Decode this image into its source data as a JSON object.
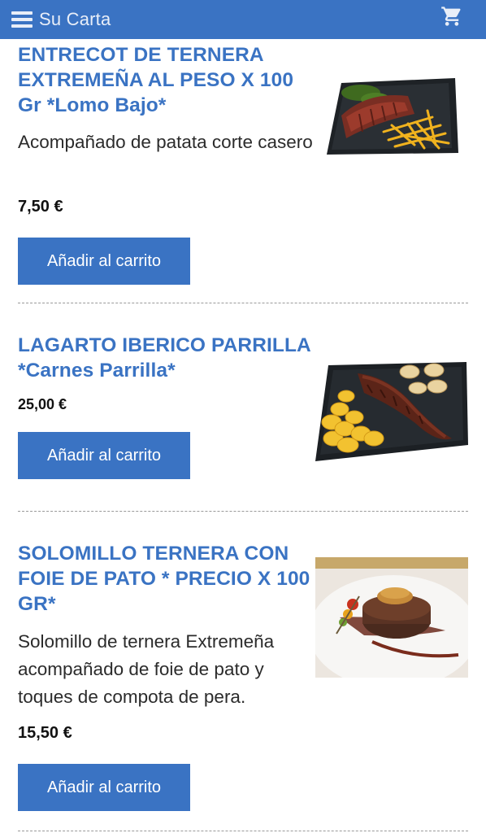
{
  "header": {
    "title": "Su Carta",
    "menu_icon": "hamburger-menu-icon",
    "cart_icon": "shopping-cart-icon",
    "bar_color": "#3a73c3"
  },
  "products": [
    {
      "name": "ENTRECOT DE TERNERA EXTREMEÑA AL PESO X 100 Gr *Lomo Bajo*",
      "description": "Acompañado de patata corte casero",
      "price": "7,50 €",
      "button": "Añadir al carrito"
    },
    {
      "name": "LAGARTO IBERICO PARRILLA *Carnes Parrilla*",
      "description": "",
      "price": "25,00 €",
      "button": "Añadir al carrito"
    },
    {
      "name": "SOLOMILLO TERNERA CON FOIE DE PATO * PRECIO X 100 GR*",
      "description": "Solomillo de ternera Extremeña acompañado de foie de pato y toques de compota de pera.",
      "price": "15,50 €",
      "button": "Añadir al carrito"
    }
  ],
  "colors": {
    "accent": "#3a73c3",
    "text": "#2b2b2b"
  }
}
